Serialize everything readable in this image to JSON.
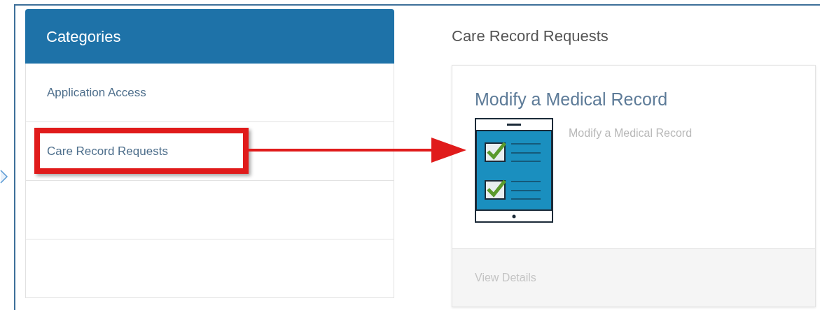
{
  "sidebar": {
    "header": "Categories",
    "items": [
      {
        "kind": "category",
        "label": "Application Access",
        "highlighted": false
      },
      {
        "kind": "category",
        "label": "Care Record Requests",
        "highlighted": true
      },
      {
        "kind": "blank"
      },
      {
        "kind": "blank"
      }
    ]
  },
  "content": {
    "title": "Care Record Requests",
    "cards": [
      {
        "title": "Modify a Medical Record",
        "description": "Modify a Medical Record",
        "footer": "View Details"
      }
    ]
  }
}
